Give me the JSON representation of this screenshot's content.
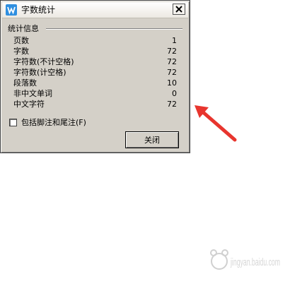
{
  "window": {
    "title": "字数统计",
    "app_icon": "wps-writer-icon"
  },
  "group": {
    "label": "统计信息"
  },
  "stats": [
    {
      "label": "页数",
      "value": "1"
    },
    {
      "label": "字数",
      "value": "72"
    },
    {
      "label": "字符数(不计空格)",
      "value": "72"
    },
    {
      "label": "字符数(计空格)",
      "value": "72"
    },
    {
      "label": "段落数",
      "value": "10"
    },
    {
      "label": "非中文单词",
      "value": "0"
    },
    {
      "label": "中文字符",
      "value": "72"
    }
  ],
  "checkbox": {
    "label": "包括脚注和尾注(F)",
    "checked": false
  },
  "buttons": {
    "close": "关闭"
  },
  "watermark": {
    "text": "jingyan.baidu.com"
  },
  "colors": {
    "dialog_bg": "#d4d0c8",
    "arrow": "#e8352e",
    "icon": "#2f8fe0"
  }
}
